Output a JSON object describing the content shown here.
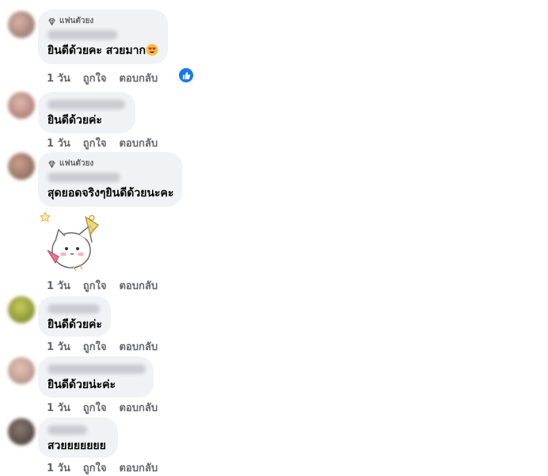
{
  "comments": [
    {
      "badge": "แฟนตัวยง",
      "author": "Jingju Chomtan",
      "text": "ยินดีด้วยคะ สวยมาก",
      "emoji": "heart-eyes-emoji",
      "time": "1 วัน",
      "like": "ถูกใจ",
      "reply": "ตอบกลับ",
      "reaction": "like"
    },
    {
      "badge": "",
      "author": "Duean Noonanthia",
      "text": "ยินดีด้วยค่ะ",
      "time": "1 วัน",
      "like": "ถูกใจ",
      "reply": "ตอบกลับ"
    },
    {
      "badge": "แฟนตัวยง",
      "author": "Siriwan Chaiin",
      "text": "สุดยอดจริงๆยินดีด้วยนะคะ",
      "time": "1 วัน",
      "like": "ถูกใจ",
      "reply": "ตอบกลับ",
      "sticker": "party-cat-sticker"
    },
    {
      "badge": "",
      "author": "Sia Khanke",
      "text": "ยินดีด้วยค่ะ",
      "time": "1 วัน",
      "like": "ถูกใจ",
      "reply": "ตอบกลับ"
    },
    {
      "badge": "",
      "author": "Amalia of Caddthai",
      "text": "ยินดีด้วยน่ะค่ะ",
      "time": "1 วัน",
      "like": "ถูกใจ",
      "reply": "ตอบกลับ"
    },
    {
      "badge": "",
      "author": "Cha Jai",
      "text": "สวยยยยยยย",
      "time": "1 วัน",
      "like": "ถูกใจ",
      "reply": "ตอบกลับ"
    }
  ],
  "colors": {
    "bubble": "#f0f2f5",
    "meta_text": "#65676b",
    "like_blue": "#1877f2"
  }
}
